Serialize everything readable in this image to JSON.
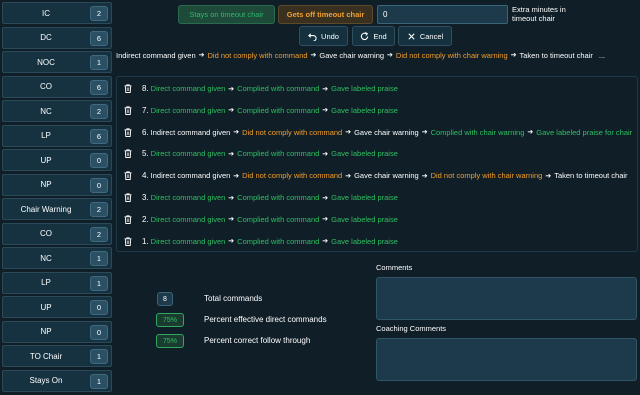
{
  "sidebar": {
    "items": [
      {
        "label": "IC",
        "count": "2"
      },
      {
        "label": "DC",
        "count": "6"
      },
      {
        "label": "NOC",
        "count": "1"
      },
      {
        "label": "CO",
        "count": "6"
      },
      {
        "label": "NC",
        "count": "2"
      },
      {
        "label": "LP",
        "count": "6"
      },
      {
        "label": "UP",
        "count": "0"
      },
      {
        "label": "NP",
        "count": "0"
      },
      {
        "label": "Chair Warning",
        "count": "2"
      },
      {
        "label": "CO",
        "count": "2"
      },
      {
        "label": "NC",
        "count": "1"
      },
      {
        "label": "LP",
        "count": "1"
      },
      {
        "label": "UP",
        "count": "0"
      },
      {
        "label": "NP",
        "count": "0"
      },
      {
        "label": "TO Chair",
        "count": "1"
      },
      {
        "label": "Stays On",
        "count": "1"
      }
    ]
  },
  "top": {
    "stays_label": "Stays on timeout chair",
    "gets_off_label": "Gets off timeout chair",
    "extra_minutes_value": "0",
    "extra_minutes_label": "Extra minutes in timeout chair"
  },
  "toolbar": {
    "undo_label": "Undo",
    "end_label": "End",
    "cancel_label": "Cancel"
  },
  "current_sequence": {
    "items": [
      {
        "text": "Indirect command given",
        "status": "neutral"
      },
      {
        "text": "Did not comply with command",
        "status": "negative"
      },
      {
        "text": "Gave chair warning",
        "status": "neutral"
      },
      {
        "text": "Did not comply with chair warning",
        "status": "negative"
      },
      {
        "text": "Taken to timeout chair",
        "status": "neutral"
      }
    ],
    "ellipsis": "..."
  },
  "sequences": [
    {
      "num": "8.",
      "steps": [
        {
          "text": "Direct command given",
          "status": "positive"
        },
        {
          "text": "Complied with command",
          "status": "positive"
        },
        {
          "text": "Gave labeled praise",
          "status": "positive"
        }
      ]
    },
    {
      "num": "7.",
      "steps": [
        {
          "text": "Direct command given",
          "status": "positive"
        },
        {
          "text": "Complied with command",
          "status": "positive"
        },
        {
          "text": "Gave labeled praise",
          "status": "positive"
        }
      ]
    },
    {
      "num": "6.",
      "steps": [
        {
          "text": "Indirect command given",
          "status": "neutral"
        },
        {
          "text": "Did not comply with command",
          "status": "negative"
        },
        {
          "text": "Gave chair warning",
          "status": "neutral"
        },
        {
          "text": "Complied with chair warning",
          "status": "positive"
        },
        {
          "text": "Gave labeled praise for chair",
          "status": "positive"
        }
      ]
    },
    {
      "num": "5.",
      "steps": [
        {
          "text": "Direct command given",
          "status": "positive"
        },
        {
          "text": "Complied with command",
          "status": "positive"
        },
        {
          "text": "Gave labeled praise",
          "status": "positive"
        }
      ]
    },
    {
      "num": "4.",
      "steps": [
        {
          "text": "Indirect command given",
          "status": "neutral"
        },
        {
          "text": "Did not comply with command",
          "status": "negative"
        },
        {
          "text": "Gave chair warning",
          "status": "neutral"
        },
        {
          "text": "Did not comply with chair warning",
          "status": "negative"
        },
        {
          "text": "Taken to timeout chair",
          "status": "neutral"
        }
      ]
    },
    {
      "num": "3.",
      "steps": [
        {
          "text": "Direct command given",
          "status": "positive"
        },
        {
          "text": "Complied with command",
          "status": "positive"
        },
        {
          "text": "Gave labeled praise",
          "status": "positive"
        }
      ]
    },
    {
      "num": "2.",
      "steps": [
        {
          "text": "Direct command given",
          "status": "positive"
        },
        {
          "text": "Complied with command",
          "status": "positive"
        },
        {
          "text": "Gave labeled praise",
          "status": "positive"
        }
      ]
    },
    {
      "num": "1.",
      "steps": [
        {
          "text": "Direct command given",
          "status": "positive"
        },
        {
          "text": "Complied with command",
          "status": "positive"
        },
        {
          "text": "Gave labeled praise",
          "status": "positive"
        }
      ]
    }
  ],
  "stats": {
    "total_value": "8",
    "total_label": "Total commands",
    "effective_value": "75%",
    "effective_label": "Percent effective direct commands",
    "follow_value": "75%",
    "follow_label": "Percent correct follow through"
  },
  "comments": {
    "comments_label": "Comments",
    "comments_value": "",
    "coaching_label": "Coaching Comments",
    "coaching_value": ""
  },
  "colors": {
    "positive": "#2fc060",
    "negative": "#f59e2a",
    "neutral": "#ffffff",
    "background": "#0f1e27"
  }
}
